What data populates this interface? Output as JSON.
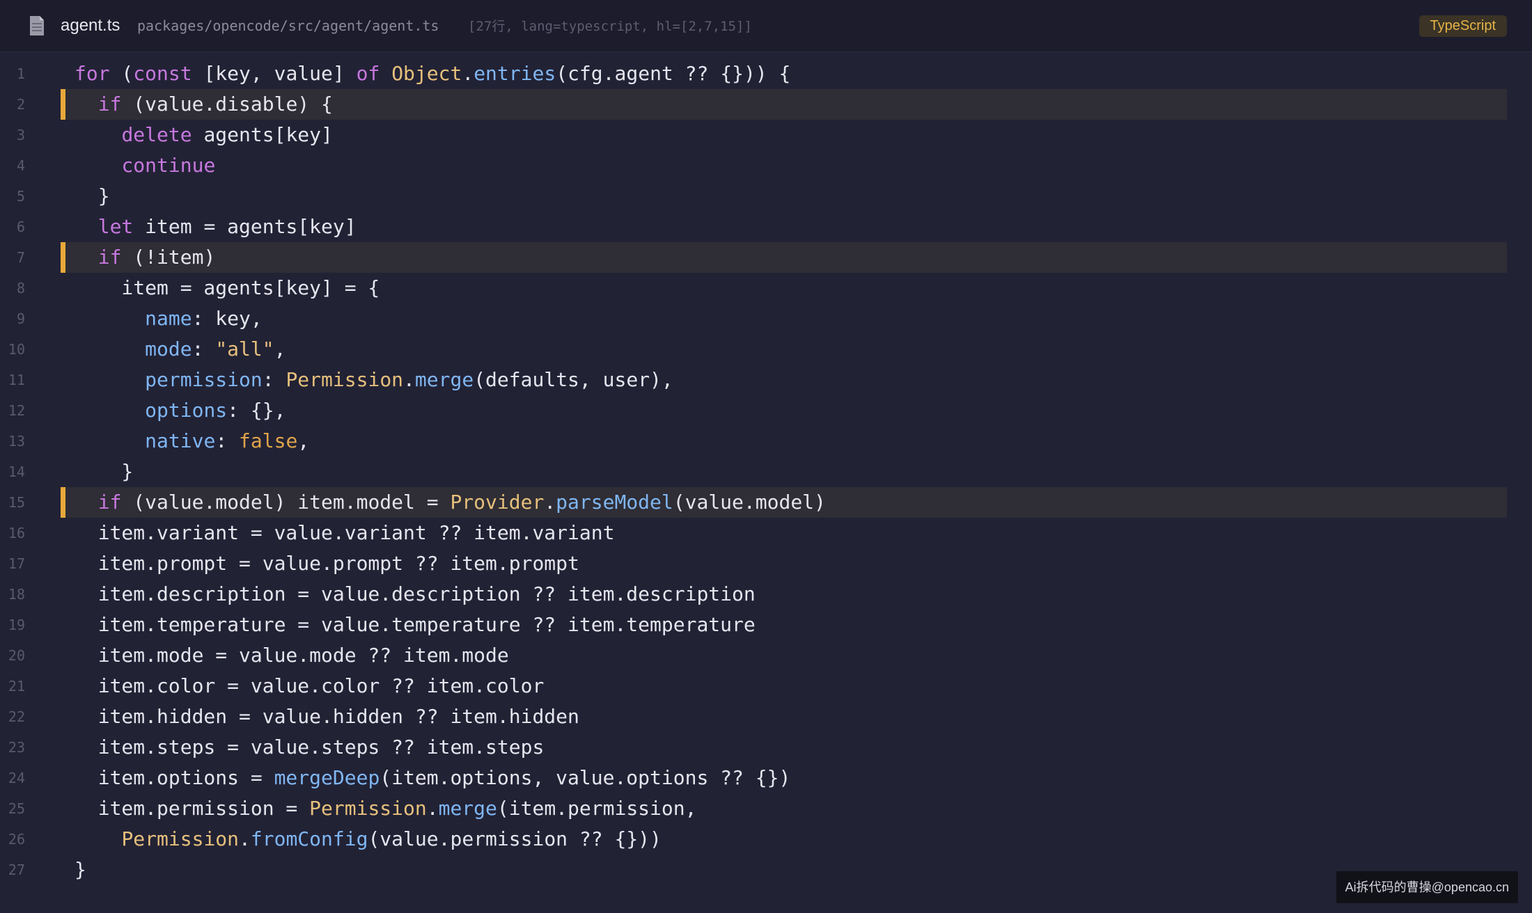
{
  "header": {
    "file_icon": "file-icon",
    "file_name": "agent.ts",
    "file_path": "packages/opencode/src/agent/agent.ts",
    "meta": "[27行, lang=typescript, hl=[2,7,15]]",
    "language": "TypeScript"
  },
  "colors": {
    "background": "#222235",
    "highlight_bar": "#e8a93a",
    "keyword": "#c678dd",
    "type": "#e6c07b",
    "function": "#7fb6f2"
  },
  "highlighted_lines": [
    2,
    7,
    15
  ],
  "code": [
    {
      "n": "1",
      "tokens": [
        {
          "t": "for",
          "c": "kw"
        },
        {
          "t": " ("
        },
        {
          "t": "const",
          "c": "kw"
        },
        {
          "t": " [key, value] "
        },
        {
          "t": "of",
          "c": "kw"
        },
        {
          "t": " "
        },
        {
          "t": "Object",
          "c": "ty"
        },
        {
          "t": "."
        },
        {
          "t": "entries",
          "c": "fn"
        },
        {
          "t": "(cfg.agent ?? {})) {"
        }
      ]
    },
    {
      "n": "2",
      "tokens": [
        {
          "t": "  "
        },
        {
          "t": "if",
          "c": "kw"
        },
        {
          "t": " (value.disable) {"
        }
      ]
    },
    {
      "n": "3",
      "tokens": [
        {
          "t": "    "
        },
        {
          "t": "delete",
          "c": "kw"
        },
        {
          "t": " agents[key]"
        }
      ]
    },
    {
      "n": "4",
      "tokens": [
        {
          "t": "    "
        },
        {
          "t": "continue",
          "c": "kw"
        }
      ]
    },
    {
      "n": "5",
      "tokens": [
        {
          "t": "  }"
        }
      ]
    },
    {
      "n": "6",
      "tokens": [
        {
          "t": "  "
        },
        {
          "t": "let",
          "c": "kw"
        },
        {
          "t": " item = agents[key]"
        }
      ]
    },
    {
      "n": "7",
      "tokens": [
        {
          "t": "  "
        },
        {
          "t": "if",
          "c": "kw"
        },
        {
          "t": " (!item)"
        }
      ]
    },
    {
      "n": "8",
      "tokens": [
        {
          "t": "    item = agents[key] = {"
        }
      ]
    },
    {
      "n": "9",
      "tokens": [
        {
          "t": "      "
        },
        {
          "t": "name",
          "c": "pr"
        },
        {
          "t": ": key,"
        }
      ]
    },
    {
      "n": "10",
      "tokens": [
        {
          "t": "      "
        },
        {
          "t": "mode",
          "c": "pr"
        },
        {
          "t": ": "
        },
        {
          "t": "\"all\"",
          "c": "st"
        },
        {
          "t": ","
        }
      ]
    },
    {
      "n": "11",
      "tokens": [
        {
          "t": "      "
        },
        {
          "t": "permission",
          "c": "pr"
        },
        {
          "t": ": "
        },
        {
          "t": "Permission",
          "c": "ty"
        },
        {
          "t": "."
        },
        {
          "t": "merge",
          "c": "fn"
        },
        {
          "t": "(defaults, user),"
        }
      ]
    },
    {
      "n": "12",
      "tokens": [
        {
          "t": "      "
        },
        {
          "t": "options",
          "c": "pr"
        },
        {
          "t": ": {},"
        }
      ]
    },
    {
      "n": "13",
      "tokens": [
        {
          "t": "      "
        },
        {
          "t": "native",
          "c": "pr"
        },
        {
          "t": ": "
        },
        {
          "t": "false",
          "c": "bo"
        },
        {
          "t": ","
        }
      ]
    },
    {
      "n": "14",
      "tokens": [
        {
          "t": "    }"
        }
      ]
    },
    {
      "n": "15",
      "tokens": [
        {
          "t": "  "
        },
        {
          "t": "if",
          "c": "kw"
        },
        {
          "t": " (value.model) item.model = "
        },
        {
          "t": "Provider",
          "c": "ty"
        },
        {
          "t": "."
        },
        {
          "t": "parseModel",
          "c": "fn"
        },
        {
          "t": "(value.model)"
        }
      ]
    },
    {
      "n": "16",
      "tokens": [
        {
          "t": "  item.variant = value.variant ?? item.variant"
        }
      ]
    },
    {
      "n": "17",
      "tokens": [
        {
          "t": "  item.prompt = value.prompt ?? item.prompt"
        }
      ]
    },
    {
      "n": "18",
      "tokens": [
        {
          "t": "  item.description = value.description ?? item.description"
        }
      ]
    },
    {
      "n": "19",
      "tokens": [
        {
          "t": "  item.temperature = value.temperature ?? item.temperature"
        }
      ]
    },
    {
      "n": "20",
      "tokens": [
        {
          "t": "  item.mode = value.mode ?? item.mode"
        }
      ]
    },
    {
      "n": "21",
      "tokens": [
        {
          "t": "  item.color = value.color ?? item.color"
        }
      ]
    },
    {
      "n": "22",
      "tokens": [
        {
          "t": "  item.hidden = value.hidden ?? item.hidden"
        }
      ]
    },
    {
      "n": "23",
      "tokens": [
        {
          "t": "  item.steps = value.steps ?? item.steps"
        }
      ]
    },
    {
      "n": "24",
      "tokens": [
        {
          "t": "  item.options = "
        },
        {
          "t": "mergeDeep",
          "c": "fn"
        },
        {
          "t": "(item.options, value.options ?? {})"
        }
      ]
    },
    {
      "n": "25",
      "tokens": [
        {
          "t": "  item.permission = "
        },
        {
          "t": "Permission",
          "c": "ty"
        },
        {
          "t": "."
        },
        {
          "t": "merge",
          "c": "fn"
        },
        {
          "t": "(item.permission,"
        }
      ]
    },
    {
      "n": "26",
      "tokens": [
        {
          "t": "    "
        },
        {
          "t": "Permission",
          "c": "ty"
        },
        {
          "t": "."
        },
        {
          "t": "fromConfig",
          "c": "fn"
        },
        {
          "t": "(value.permission ?? {}))"
        }
      ]
    },
    {
      "n": "27",
      "tokens": [
        {
          "t": "}"
        }
      ]
    }
  ],
  "watermark": "Ai拆代码的曹操@opencao.cn"
}
